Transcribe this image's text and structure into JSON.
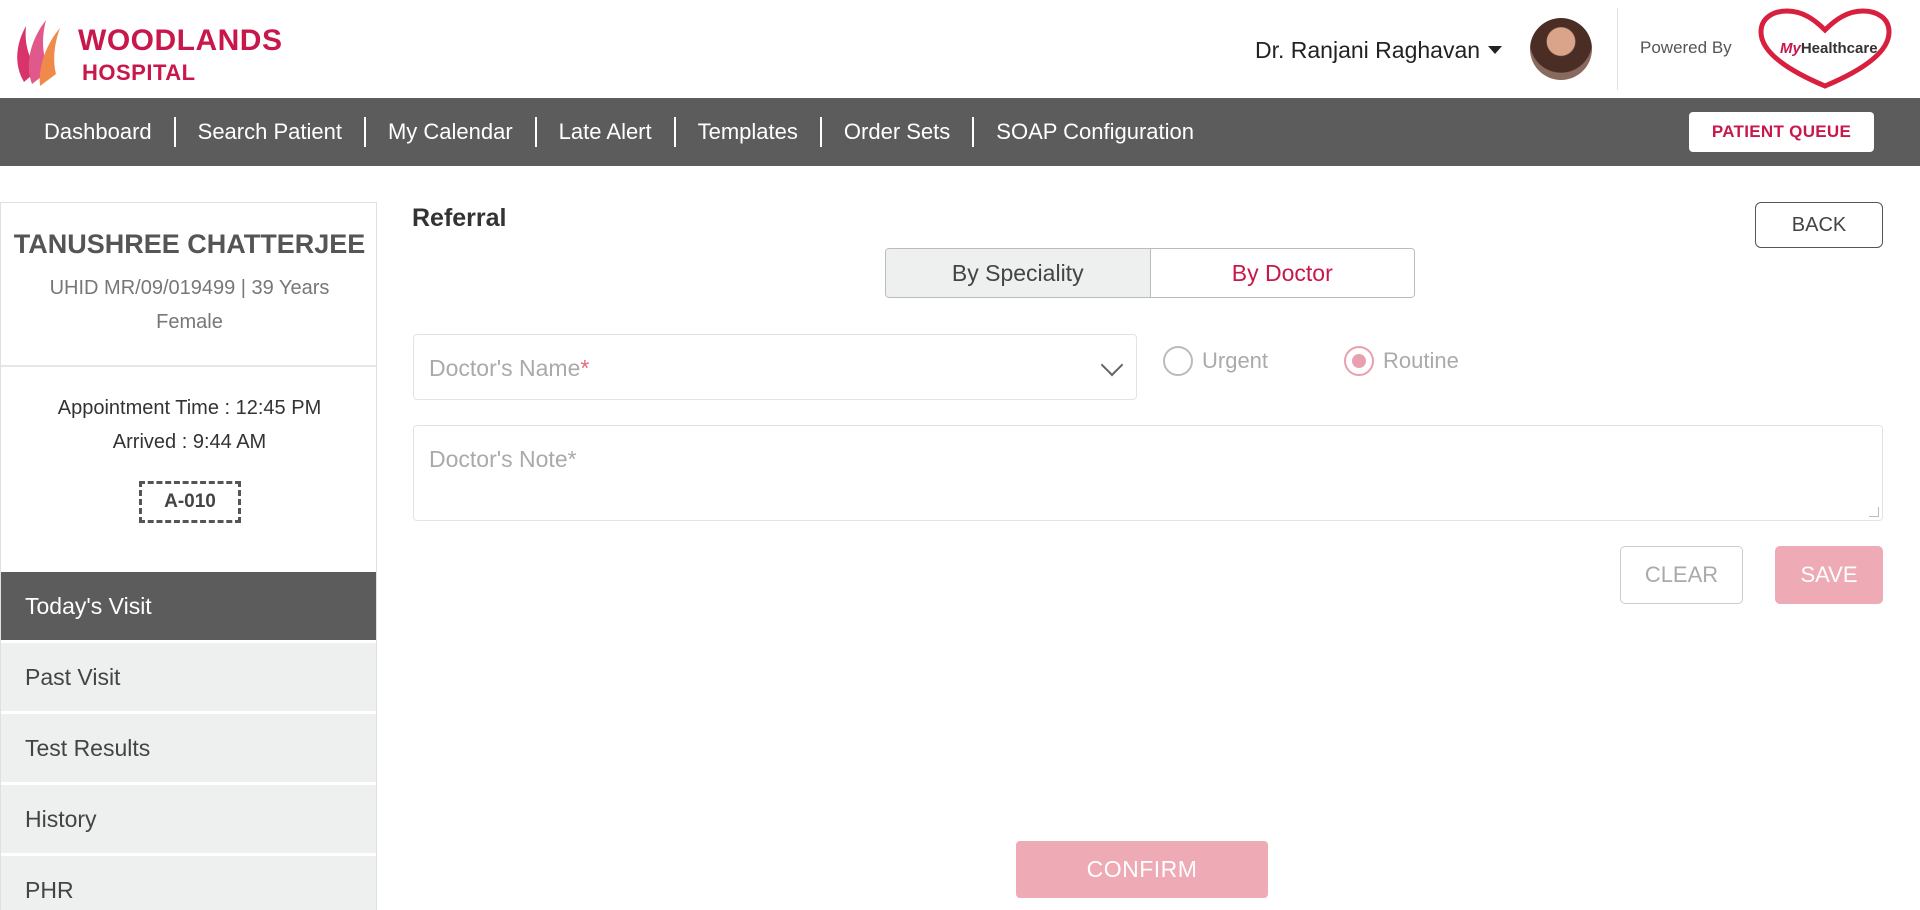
{
  "header": {
    "logo_line1": "WOODLANDS",
    "logo_line2": "HOSPITAL",
    "doctor_name": "Dr. Ranjani Raghavan",
    "powered_by": "Powered By",
    "partner_logo_prefix": "My",
    "partner_logo_name": "Healthcare",
    "brand_color": "#c8174b"
  },
  "nav": {
    "items": [
      {
        "label": "Dashboard"
      },
      {
        "label": "Search Patient"
      },
      {
        "label": "My Calendar"
      },
      {
        "label": "Late Alert"
      },
      {
        "label": "Templates"
      },
      {
        "label": "Order Sets"
      },
      {
        "label": "SOAP Configuration"
      }
    ],
    "patient_queue": "PATIENT QUEUE"
  },
  "patient": {
    "name": "TANUSHREE CHATTERJEE",
    "meta_line1": "UHID MR/09/019499 | 39 Years",
    "meta_line2": "Female",
    "appointment_time": "Appointment Time : 12:45 PM",
    "arrived": "Arrived : 9:44 AM",
    "token": "A-010"
  },
  "sidebar_menu": [
    {
      "label": "Today's Visit",
      "active": true
    },
    {
      "label": "Past Visit",
      "active": false
    },
    {
      "label": "Test Results",
      "active": false
    },
    {
      "label": "History",
      "active": false
    },
    {
      "label": "PHR",
      "active": false
    }
  ],
  "referral": {
    "title": "Referral",
    "back": "BACK",
    "toggle_speciality": "By Speciality",
    "toggle_doctor": "By Doctor",
    "selected_mode": "By Doctor",
    "doctor_name_placeholder": "Doctor's Name",
    "required_mark": "*",
    "priority_urgent": "Urgent",
    "priority_routine": "Routine",
    "selected_priority": "Routine",
    "doctor_note_placeholder": "Doctor's Note*",
    "clear": "CLEAR",
    "save": "SAVE",
    "confirm": "CONFIRM"
  }
}
